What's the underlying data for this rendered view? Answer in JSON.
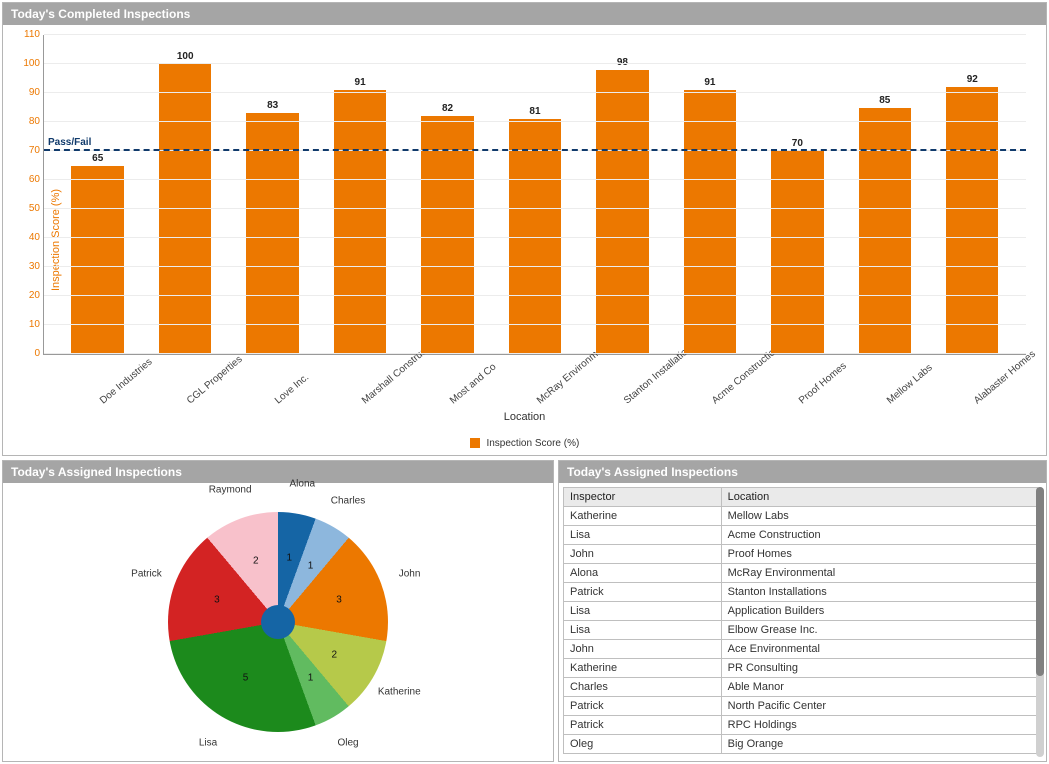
{
  "panels": {
    "bar": {
      "title": "Today's Completed Inspections"
    },
    "pie": {
      "title": "Today's Assigned Inspections"
    },
    "table": {
      "title": "Today's Assigned Inspections"
    }
  },
  "chart_data": [
    {
      "id": "completed_inspections_bar",
      "type": "bar",
      "title": "Today's Completed Inspections",
      "xlabel": "Location",
      "ylabel": "Inspection Score (%)",
      "ylim": [
        0,
        110
      ],
      "y_ticks": [
        0,
        10,
        20,
        30,
        40,
        50,
        60,
        70,
        80,
        90,
        100,
        110
      ],
      "threshold": {
        "value": 70,
        "label": "Pass/Fail"
      },
      "categories": [
        "Doe Industries",
        "CGL Properties",
        "Love Inc.",
        "Marshall Construction",
        "Most and Co",
        "McRay Environmental",
        "Stanton Installations",
        "Acme Construction",
        "Proof Homes",
        "Mellow Labs",
        "Alabaster Homes"
      ],
      "values": [
        65,
        100,
        83,
        91,
        82,
        81,
        98,
        91,
        70,
        85,
        92
      ],
      "series_legend": "Inspection Score (%)",
      "bar_color": "#ec7800"
    },
    {
      "id": "assigned_inspections_pie",
      "type": "pie",
      "title": "Today's Assigned Inspections",
      "series": [
        {
          "name": "Alona",
          "value": 1,
          "color": "#1565a5"
        },
        {
          "name": "Charles",
          "value": 1,
          "color": "#8db7dd"
        },
        {
          "name": "John",
          "value": 3,
          "color": "#ec7800"
        },
        {
          "name": "Katherine",
          "value": 2,
          "color": "#b6c94a"
        },
        {
          "name": "Oleg",
          "value": 1,
          "color": "#61bb60"
        },
        {
          "name": "Lisa",
          "value": 5,
          "color": "#1c8a1c"
        },
        {
          "name": "Patrick",
          "value": 3,
          "color": "#d32323"
        },
        {
          "name": "Raymond",
          "value": 2,
          "color": "#f8c1cb"
        }
      ]
    }
  ],
  "assigned_table": {
    "columns": [
      "Inspector",
      "Location"
    ],
    "rows": [
      [
        "Katherine",
        "Mellow Labs"
      ],
      [
        "Lisa",
        "Acme Construction"
      ],
      [
        "John",
        "Proof Homes"
      ],
      [
        "Alona",
        "McRay Environmental"
      ],
      [
        "Patrick",
        "Stanton Installations"
      ],
      [
        "Lisa",
        "Application Builders"
      ],
      [
        "Lisa",
        "Elbow Grease Inc."
      ],
      [
        "John",
        "Ace Environmental"
      ],
      [
        "Katherine",
        "PR Consulting"
      ],
      [
        "Charles",
        "Able Manor"
      ],
      [
        "Patrick",
        "North Pacific Center"
      ],
      [
        "Patrick",
        "RPC Holdings"
      ],
      [
        "Oleg",
        "Big Orange"
      ]
    ]
  }
}
